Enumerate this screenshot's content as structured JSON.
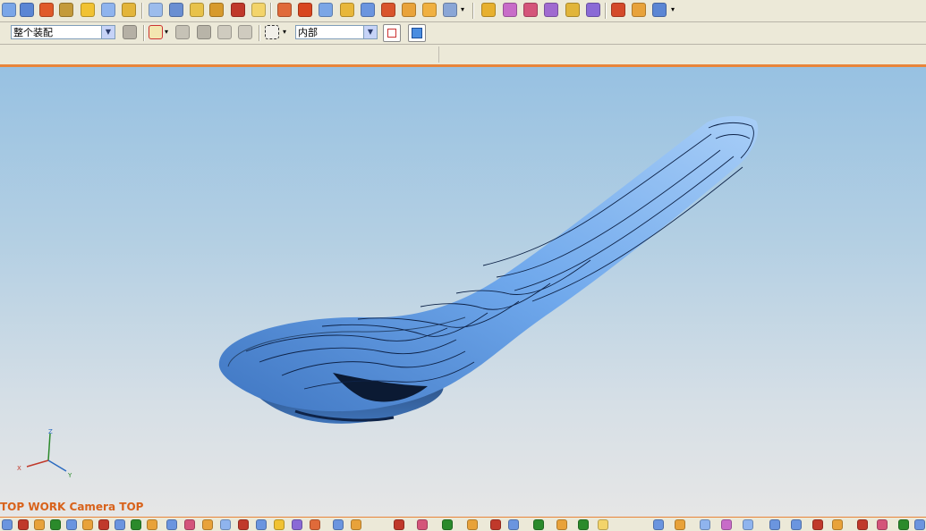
{
  "toolbar_top": {
    "icons": [
      "open-icon",
      "save-icon",
      "paint-icon",
      "assembly-icon",
      "sheet-icon",
      "copy-icon",
      "hammer-icon",
      "cube-edit-icon",
      "link-icon",
      "layers-icon",
      "cylinder-icon",
      "tools-icon",
      "sweep-icon",
      "shell-icon",
      "chamfer-icon",
      "edge-icon",
      "trim-icon",
      "extrude-icon",
      "rotate-icon",
      "sew-icon",
      "fillet-icon",
      "gear-icon",
      "offset-icon",
      "mirror-icon",
      "transform-icon",
      "analysis-icon",
      "grid-icon"
    ],
    "colors": {
      "accent_orange": "#e8853a",
      "icon_blue": "#4a7fd0",
      "icon_yellow": "#f1c232",
      "icon_red": "#d44a2a"
    }
  },
  "toolbar_selection": {
    "assembly_filter": {
      "value": "整个装配"
    },
    "selection_scope": {
      "value": "内部"
    }
  },
  "viewport": {
    "model": "spoon-model",
    "view_name": "TOP WORK Camera TOP",
    "triad": {
      "x_label": "X",
      "y_label": "Y",
      "z_label": "Z"
    },
    "colors": {
      "background_top": "#97c1e2",
      "background_bottom": "#e6e6e6",
      "model_fill": "#6ea7ea",
      "label_color": "#d8621b"
    }
  },
  "toolbar_bottom": {
    "icons": [
      "point-icon",
      "line-icon",
      "arc-icon",
      "curve-icon",
      "spline-icon",
      "offset-curve-icon",
      "project-icon",
      "intersect-icon",
      "measure-icon",
      "dimension-icon",
      "section-icon",
      "ruler-icon",
      "snap-icon",
      "grid-toggle-icon",
      "filter-icon",
      "render-icon"
    ]
  }
}
